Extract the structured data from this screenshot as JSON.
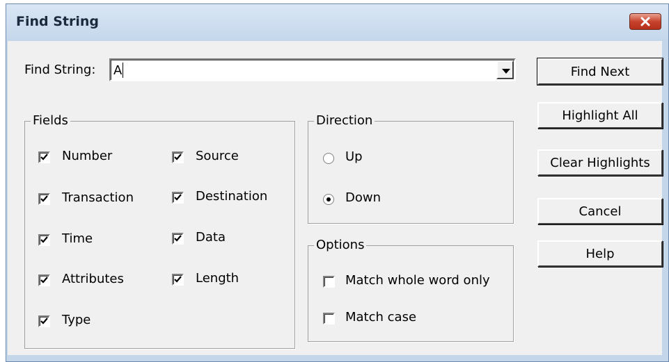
{
  "window": {
    "title": "Find String"
  },
  "find": {
    "label": "Find String:",
    "value": "A"
  },
  "fields": {
    "title": "Fields",
    "items": [
      {
        "label": "Number",
        "checked": true
      },
      {
        "label": "Source",
        "checked": true
      },
      {
        "label": "Transaction",
        "checked": true
      },
      {
        "label": "Destination",
        "checked": true
      },
      {
        "label": "Time",
        "checked": true
      },
      {
        "label": "Data",
        "checked": true
      },
      {
        "label": "Attributes",
        "checked": true
      },
      {
        "label": "Length",
        "checked": true
      },
      {
        "label": "Type",
        "checked": true
      }
    ]
  },
  "direction": {
    "title": "Direction",
    "options": [
      {
        "label": "Up",
        "selected": false
      },
      {
        "label": "Down",
        "selected": true
      }
    ]
  },
  "options": {
    "title": "Options",
    "items": [
      {
        "label": "Match whole word only",
        "checked": false
      },
      {
        "label": "Match case",
        "checked": false
      }
    ]
  },
  "buttons": {
    "find_next": "Find Next",
    "highlight_all": "Highlight All",
    "clear_highlights": "Clear Highlights",
    "cancel": "Cancel",
    "help": "Help"
  },
  "colors": {
    "titlebar": "#c6d8ec",
    "close": "#c8432d",
    "face": "#f0f0f0"
  }
}
